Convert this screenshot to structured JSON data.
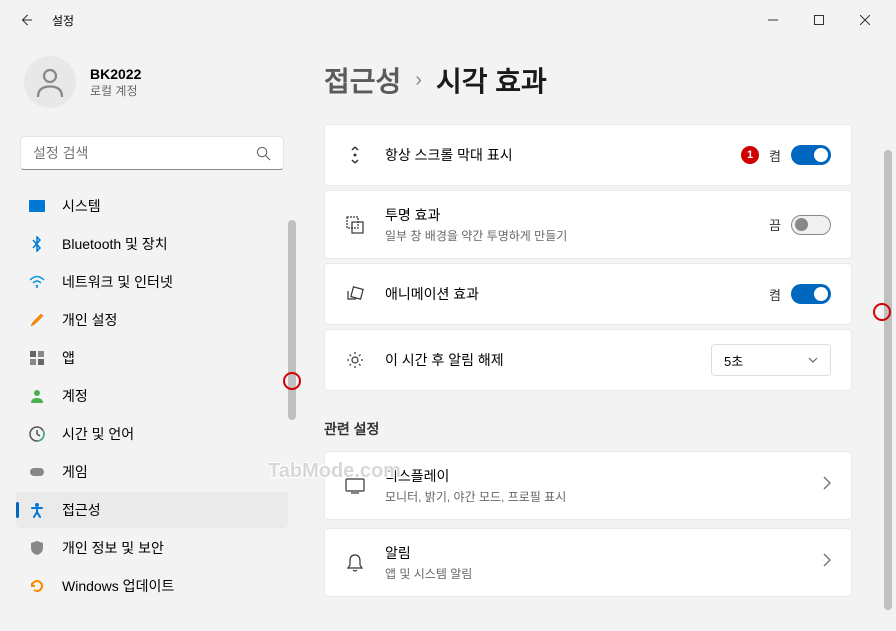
{
  "titlebar": {
    "title": "설정"
  },
  "user": {
    "name": "BK2022",
    "account_type": "로컬 계정"
  },
  "search": {
    "placeholder": "설정 검색"
  },
  "nav": {
    "items": [
      {
        "label": "시스템",
        "icon": "system"
      },
      {
        "label": "Bluetooth 및 장치",
        "icon": "bluetooth"
      },
      {
        "label": "네트워크 및 인터넷",
        "icon": "network"
      },
      {
        "label": "개인 설정",
        "icon": "personalize"
      },
      {
        "label": "앱",
        "icon": "apps"
      },
      {
        "label": "계정",
        "icon": "accounts"
      },
      {
        "label": "시간 및 언어",
        "icon": "time"
      },
      {
        "label": "게임",
        "icon": "gaming"
      },
      {
        "label": "접근성",
        "icon": "accessibility",
        "selected": true
      },
      {
        "label": "개인 정보 및 보안",
        "icon": "privacy"
      },
      {
        "label": "Windows 업데이트",
        "icon": "update"
      }
    ]
  },
  "breadcrumb": {
    "parent": "접근성",
    "current": "시각 효과"
  },
  "settings": {
    "scrollbars": {
      "title": "항상 스크롤 막대 표시",
      "state_label": "켬",
      "on": true
    },
    "transparency": {
      "title": "투명 효과",
      "desc": "일부 창 배경을 약간 투명하게 만들기",
      "state_label": "끔",
      "on": false
    },
    "animations": {
      "title": "애니메이션 효과",
      "state_label": "켬",
      "on": true
    },
    "notifications": {
      "title": "이 시간 후 알림 해제",
      "selected": "5초"
    }
  },
  "related": {
    "header": "관련 설정",
    "display": {
      "title": "디스플레이",
      "desc": "모니터, 밝기, 야간 모드, 프로필 표시"
    },
    "notif": {
      "title": "알림",
      "desc": "앱 및 시스템 알림"
    }
  },
  "annotation": {
    "badge": "1"
  },
  "watermark": "TabMode.com"
}
